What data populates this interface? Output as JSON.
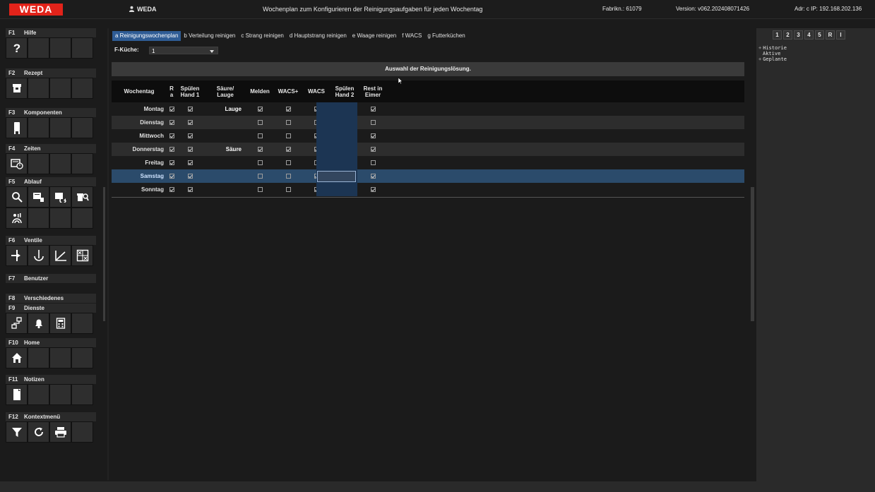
{
  "header": {
    "logo": "WEDA",
    "user": "WEDA",
    "title": "Wochenplan zum Konfigurieren der Reinigungsaufgaben für jeden Wochentag",
    "fabrik": "Fabrikn.: 61079",
    "version": "Version: v062.20240807142​6",
    "adr": "Adr: c  IP: 192.168.202.136"
  },
  "sidebar": {
    "sections": [
      {
        "key": "F1",
        "label": "Hilfe",
        "icons": [
          "help-icon"
        ]
      },
      {
        "key": "F2",
        "label": "Rezept",
        "icons": [
          "recipe-icon"
        ]
      },
      {
        "key": "F3",
        "label": "Komponenten",
        "icons": [
          "silo-icon"
        ]
      },
      {
        "key": "F4",
        "label": "Zeiten",
        "icons": [
          "timer-icon"
        ]
      },
      {
        "key": "F5",
        "label": "Ablauf",
        "icons": [
          "search-icon",
          "flow-icon",
          "flow-edit-icon",
          "trough-search-icon",
          "sensor-icon"
        ]
      },
      {
        "key": "F6",
        "label": "Ventile",
        "icons": [
          "valve-icon",
          "valve-down-icon",
          "curve-icon",
          "grid-icon"
        ]
      },
      {
        "key": "F7",
        "label": "Benutzer",
        "icons": []
      },
      {
        "key": "F8",
        "label": "Verschiedenes",
        "icons": []
      },
      {
        "key": "F9",
        "label": "Dienste",
        "icons": [
          "network-icon",
          "bell-icon",
          "calculator-icon"
        ]
      },
      {
        "key": "F10",
        "label": "Home",
        "icons": [
          "home-icon"
        ]
      },
      {
        "key": "F11",
        "label": "Notizen",
        "icons": [
          "notes-icon"
        ]
      },
      {
        "key": "F12",
        "label": "Kontextmenü",
        "icons": [
          "filter-icon",
          "refresh-icon",
          "print-icon"
        ]
      }
    ]
  },
  "tabs": [
    {
      "label": "a Reinigungswochenplan",
      "active": true
    },
    {
      "label": "b Verteilung reinigen",
      "active": false
    },
    {
      "label": "c Strang reinigen",
      "active": false
    },
    {
      "label": "d Hauptstrang reinigen",
      "active": false
    },
    {
      "label": "e Waage reinigen",
      "active": false
    },
    {
      "label": "f WACS",
      "active": false
    },
    {
      "label": "g Futterküchen",
      "active": false
    }
  ],
  "fkuche": {
    "label": "F-Küche:",
    "value": "1"
  },
  "banner": "Auswahl der Reinigungslösung.",
  "table": {
    "headers": [
      {
        "key": "tag",
        "text": "Wochentag"
      },
      {
        "key": "r",
        "text": "R\na"
      },
      {
        "key": "sp1",
        "text": "Spülen\nHand 1"
      },
      {
        "key": "sol",
        "text": "Säure/\nLauge"
      },
      {
        "key": "melden",
        "text": "Melden"
      },
      {
        "key": "wacsp",
        "text": "WACS+"
      },
      {
        "key": "wacs",
        "text": "WACS"
      },
      {
        "key": "sp2",
        "text": "Spülen\nHand 2"
      },
      {
        "key": "rest",
        "text": "Rest in\nEimer"
      }
    ],
    "rows": [
      {
        "day": "Montag",
        "r": true,
        "sp1": true,
        "sol": "Lauge",
        "melden": true,
        "wacsp": true,
        "wacs": true,
        "sp2": true,
        "rest": true,
        "style": "normal"
      },
      {
        "day": "Dienstag",
        "r": true,
        "sp1": true,
        "sol": "",
        "melden": false,
        "wacsp": false,
        "wacs": false,
        "sp2": false,
        "rest": false,
        "style": "alt"
      },
      {
        "day": "Mittwoch",
        "r": true,
        "sp1": true,
        "sol": "",
        "melden": false,
        "wacsp": false,
        "wacs": true,
        "sp2": true,
        "rest": true,
        "style": "normal"
      },
      {
        "day": "Donnerstag",
        "r": true,
        "sp1": true,
        "sol": "Säure",
        "melden": true,
        "wacsp": true,
        "wacs": true,
        "sp2": true,
        "rest": true,
        "style": "alt"
      },
      {
        "day": "Freitag",
        "r": true,
        "sp1": true,
        "sol": "",
        "melden": false,
        "wacsp": false,
        "wacs": false,
        "sp2": false,
        "rest": false,
        "style": "normal"
      },
      {
        "day": "Samstag",
        "r": true,
        "sp1": true,
        "sol": "",
        "melden": false,
        "wacsp": false,
        "wacs": true,
        "sp2": true,
        "rest": true,
        "style": "sel"
      },
      {
        "day": "Sonntag",
        "r": true,
        "sp1": true,
        "sol": "",
        "melden": false,
        "wacsp": false,
        "wacs": true,
        "sp2": true,
        "rest": true,
        "style": "normal"
      }
    ]
  },
  "right_panel": {
    "tabs": [
      "1",
      "2",
      "3",
      "4",
      "5",
      "R",
      "I"
    ],
    "tree": [
      {
        "toggle": "+",
        "label": "Historie"
      },
      {
        "toggle": "",
        "label": "Aktive"
      },
      {
        "toggle": "+",
        "label": "Geplante"
      }
    ]
  },
  "colors": {
    "brand": "#e2231a",
    "active_tab": "#2f5c95",
    "selection": "#2b4b6b"
  }
}
